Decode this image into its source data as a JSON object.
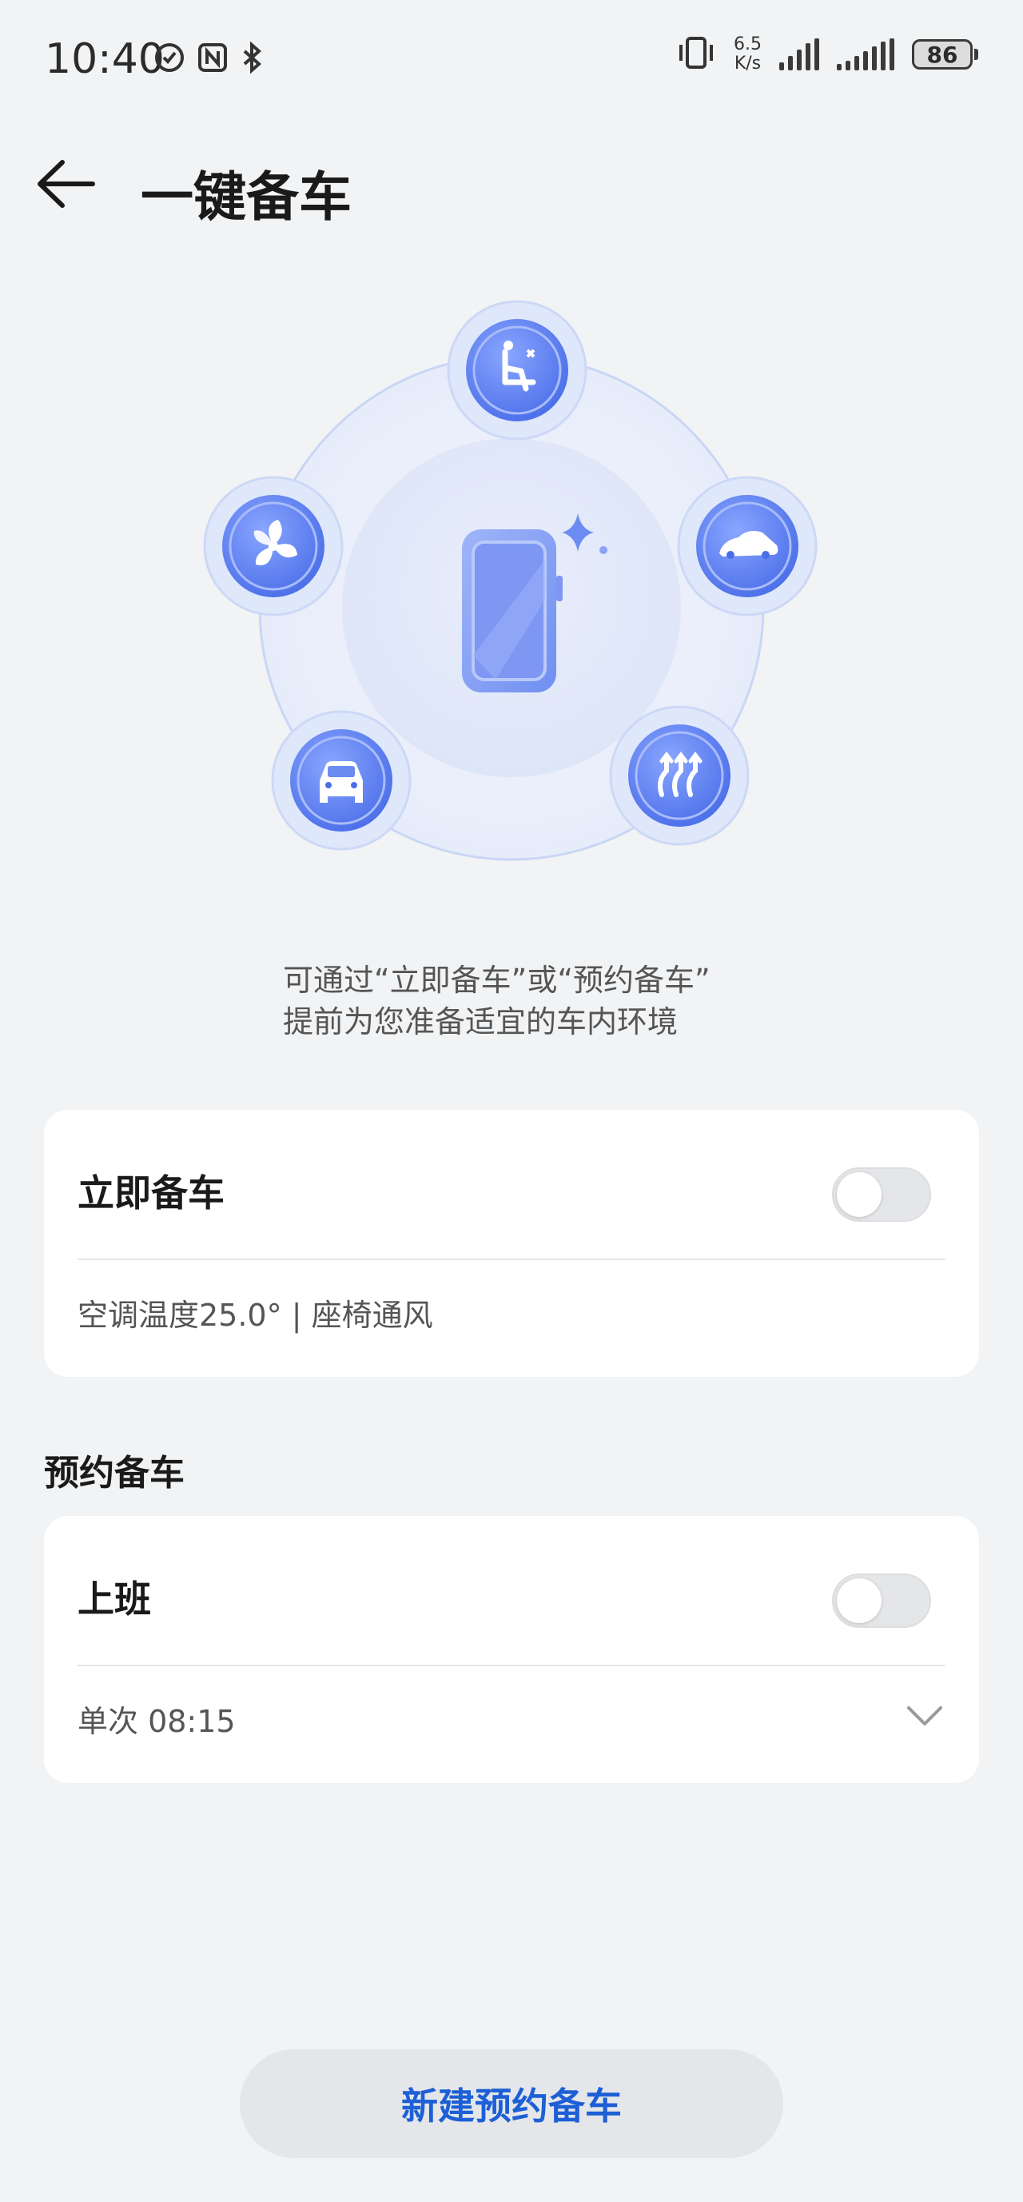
{
  "status_bar": {
    "time": "10:40",
    "net_speed_value": "6.5",
    "net_speed_unit": "K/s",
    "battery": "86"
  },
  "header": {
    "title": "一键备车"
  },
  "description": {
    "line1": "可通过“立即备车”或“预约备车”",
    "line2": "提前为您准备适宜的车内环境"
  },
  "instant_card": {
    "title": "立即备车",
    "toggle_on": false,
    "summary": "空调温度25.0° | 座椅通风"
  },
  "scheduled_section": {
    "title": "预约备车",
    "items": [
      {
        "title": "上班",
        "toggle_on": false,
        "schedule": "单次 08:15"
      }
    ]
  },
  "bottom_button": {
    "label": "新建预约备车"
  },
  "colors": {
    "accent": "#1d5fd6",
    "icon_blue": "#5b7fef",
    "background": "#f1f3f5"
  }
}
